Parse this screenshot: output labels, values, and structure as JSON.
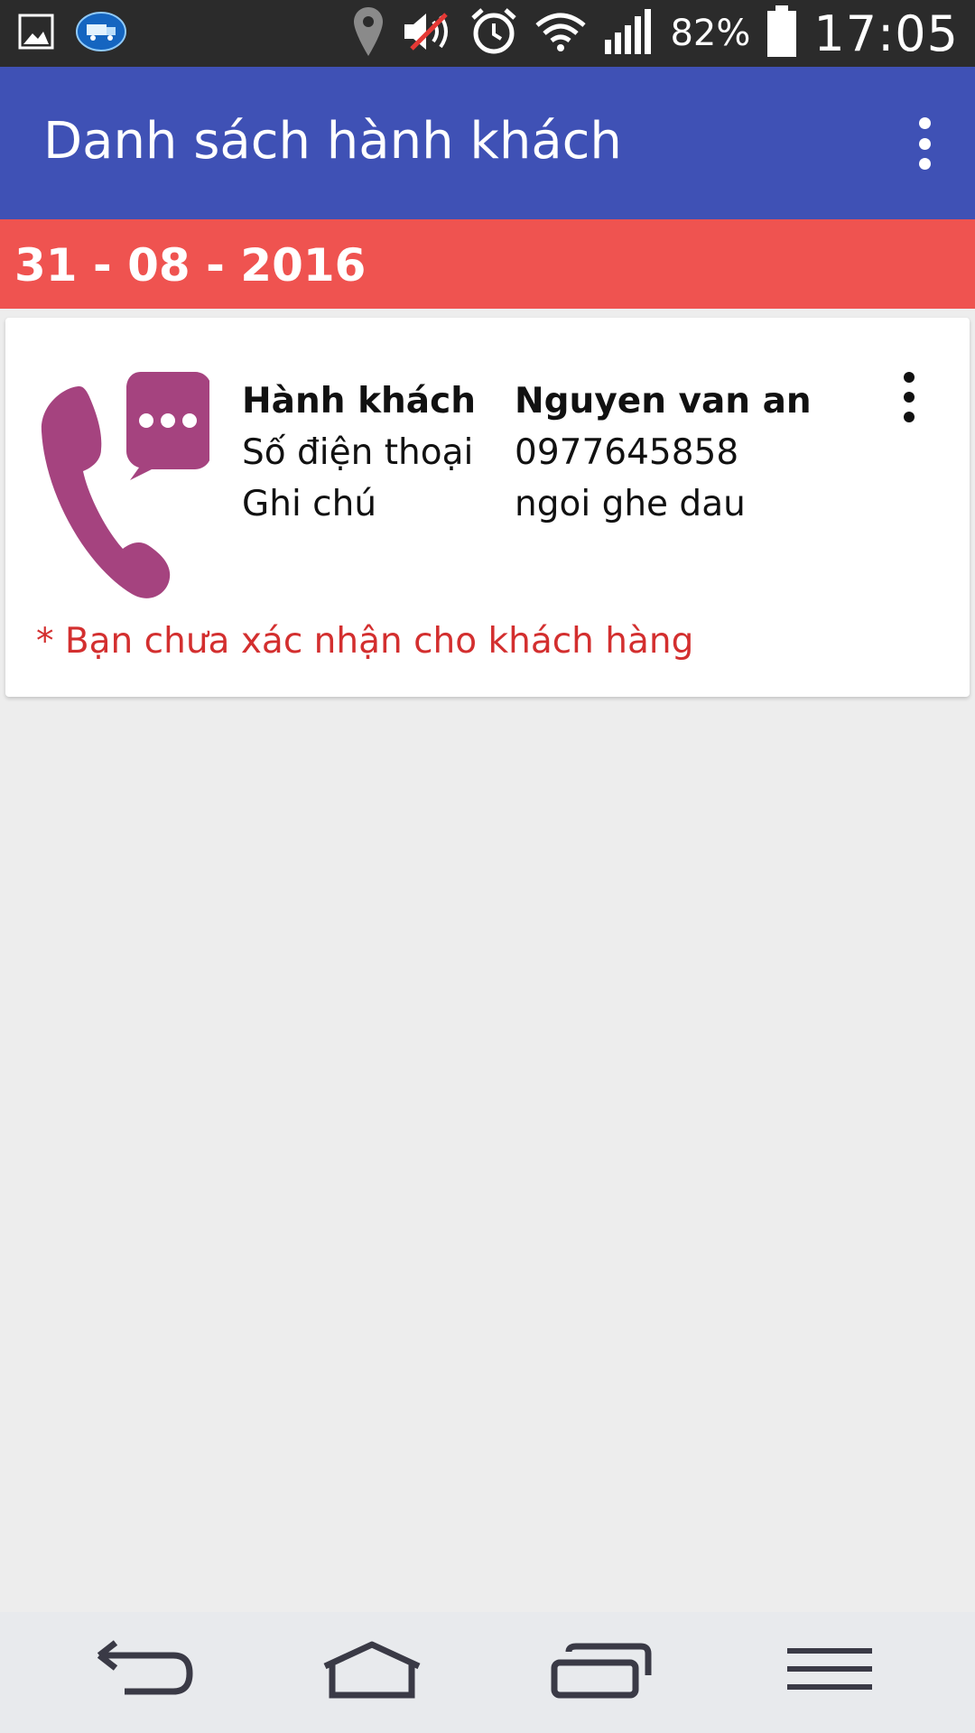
{
  "status_bar": {
    "battery_percent": "82%",
    "time": "17:05",
    "icons": [
      "gallery-icon",
      "truck-app-icon",
      "location-icon",
      "mute-icon",
      "alarm-icon",
      "wifi-icon",
      "signal-icon",
      "battery-icon"
    ]
  },
  "app_bar": {
    "title": "Danh sách hành khách",
    "menu_icon": "overflow-menu-icon",
    "color": "#3f51b5"
  },
  "date_header": {
    "date": "31 - 08 - 2016",
    "color": "#ef5350"
  },
  "passengers": [
    {
      "icon": "phone-chat-icon",
      "icon_color": "#a5437f",
      "fields": [
        {
          "label": "Hành khách",
          "value": "Nguyen van an"
        },
        {
          "label": "Số điện thoại",
          "value": "0977645858"
        },
        {
          "label": "Ghi chú",
          "value": "ngoi ghe dau"
        }
      ],
      "warning": "* Bạn chưa xác nhận cho khách hàng",
      "warning_color": "#d32f2f"
    }
  ],
  "nav_bar": {
    "buttons": [
      "back-icon",
      "home-icon",
      "recents-icon",
      "menu-icon"
    ]
  }
}
